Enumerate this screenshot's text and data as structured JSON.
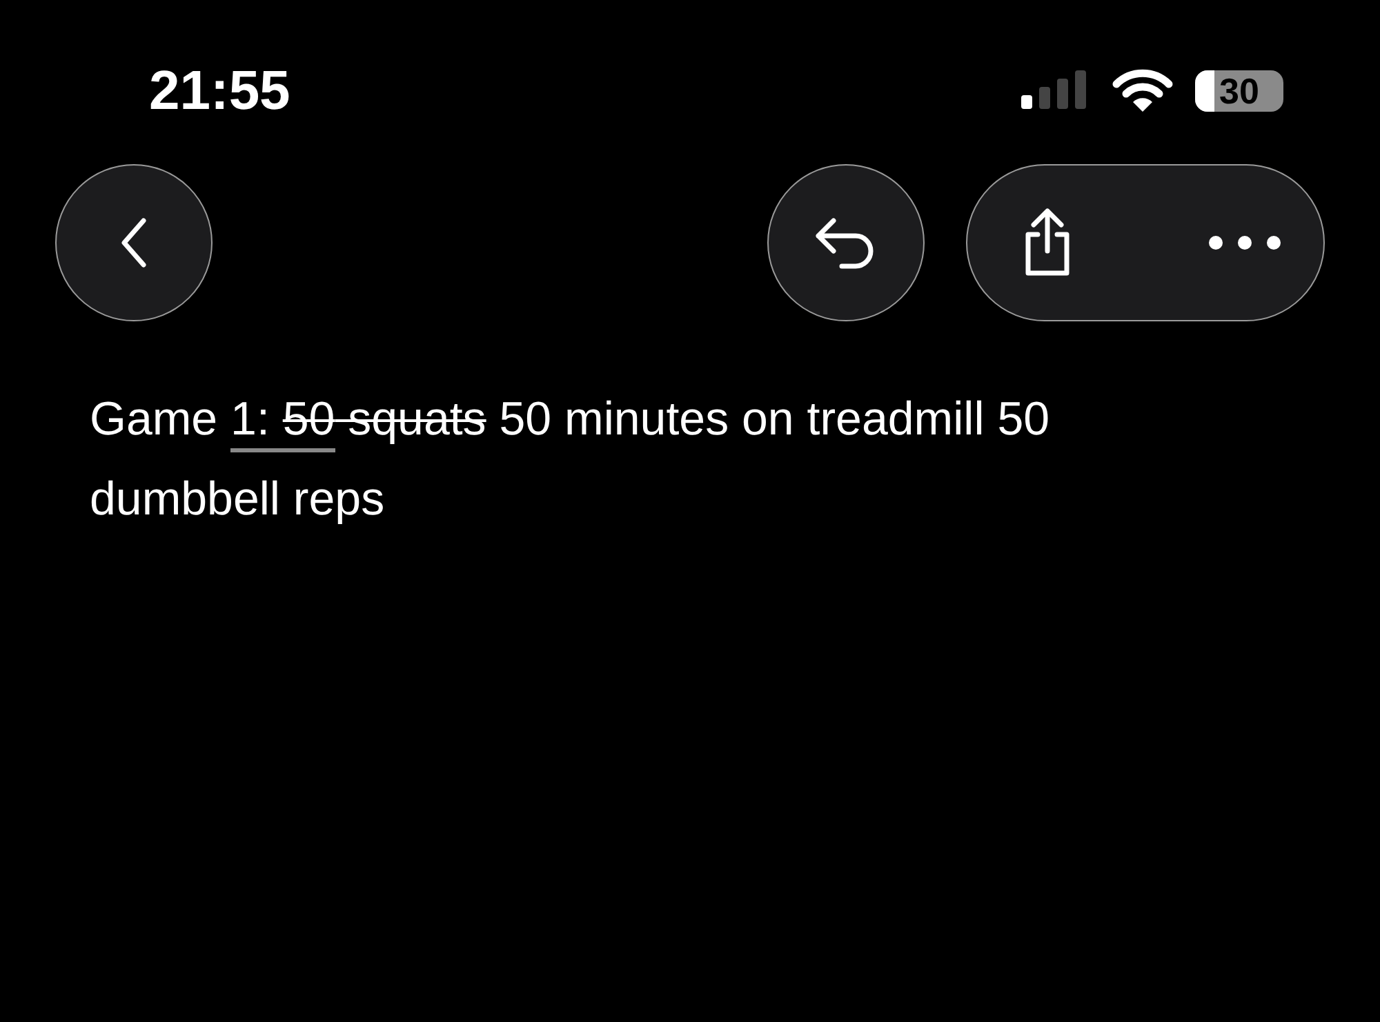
{
  "status_bar": {
    "time": "21:55",
    "battery": "30"
  },
  "toolbar": {
    "buttons": [
      {
        "kind": "back"
      },
      {
        "kind": "undo"
      }
    ],
    "pill": [
      {
        "kind": "share"
      },
      {
        "kind": "more"
      }
    ]
  },
  "note": {
    "segments": [
      {
        "text": "Game ",
        "underline": false,
        "strike": false
      },
      {
        "text": "1: ",
        "underline": true,
        "strike": false
      },
      {
        "text": "50",
        "underline": true,
        "strike": true
      },
      {
        "text": " squats",
        "underline": false,
        "strike": true
      },
      {
        "text": " 50 minutes on treadmill 50 dumbbell reps",
        "underline": false,
        "strike": false
      }
    ]
  }
}
